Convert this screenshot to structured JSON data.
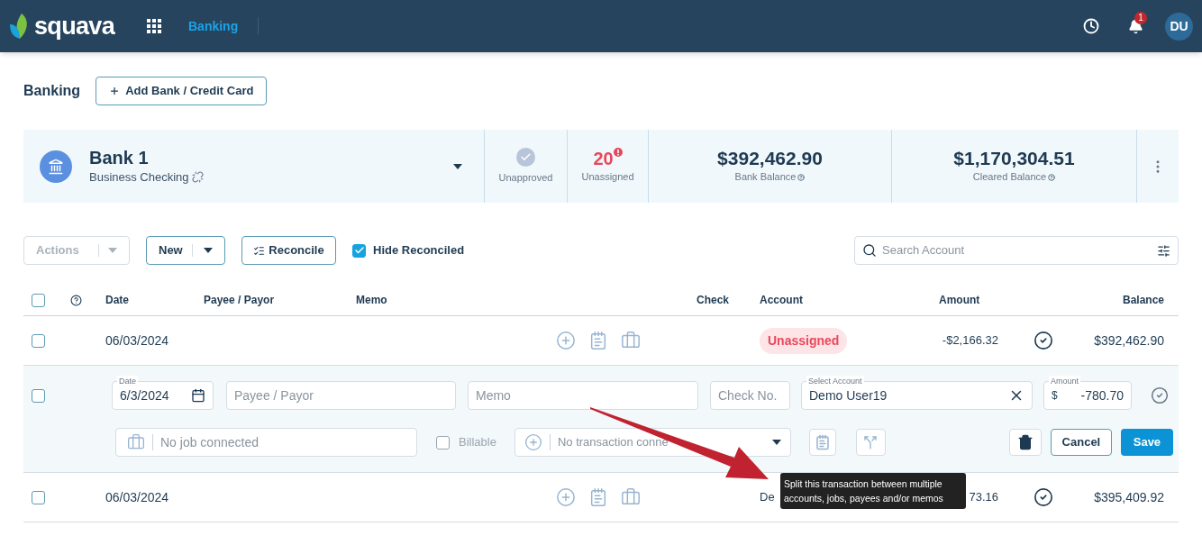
{
  "header": {
    "logo": "squava",
    "nav": [
      {
        "label": "Banking",
        "selected": true
      }
    ],
    "notifications": "1",
    "avatar": "DU"
  },
  "page": {
    "title": "Banking",
    "add_button": "Add Bank / Credit Card"
  },
  "account_card": {
    "name": "Bank 1",
    "type": "Business Checking",
    "unapproved": "Unapproved",
    "unassigned_count": "20",
    "unassigned": "Unassigned",
    "balances": [
      {
        "value": "$392,462.90",
        "label": "Bank Balance"
      },
      {
        "value": "$1,170,304.51",
        "label": "Cleared Balance"
      }
    ]
  },
  "toolbar": {
    "actions": {
      "label": "Actions",
      "disabled": true
    },
    "new": "New",
    "reconcile": "Reconcile",
    "hide_reconciled": {
      "label": "Hide Reconciled",
      "checked": true
    },
    "search": {
      "placeholder": "Search Account"
    }
  },
  "table": {
    "select_all": false,
    "columns": [
      "Date",
      "Payee / Payor",
      "Memo",
      "Check",
      "Account",
      "Amount",
      "Balance"
    ],
    "rows": [
      {
        "kind": "row",
        "checked": false,
        "date": "06/03/2024",
        "account": "Unassigned",
        "flagged": true,
        "amount": "-$2,166.32",
        "approved": true,
        "balance": "$392,462.90"
      },
      {
        "kind": "edit",
        "checked": false,
        "date_label": "Date",
        "date_input": "6/3/2024",
        "payee_placeholder": "Payee / Payor",
        "memo_placeholder": "Memo",
        "check_placeholder": "Check No.",
        "account_label": "Select Account",
        "account_input": "Demo User19",
        "amount_label": "Amount",
        "currency": "$",
        "amount_input": "-780.70",
        "approved": false,
        "job_placeholder": "No job connected",
        "billable": {
          "label": "Billable",
          "checked": false
        },
        "transaction_placeholder": "No transaction conne",
        "cancel": "Cancel",
        "save": "Save"
      },
      {
        "kind": "row",
        "checked": false,
        "date": "06/03/2024",
        "account": "De",
        "flagged": false,
        "amount": "73.16",
        "approved": true,
        "balance": "$395,409.92"
      }
    ]
  },
  "tooltip": "Split this transaction between multiple accounts, jobs, payees and/or memos"
}
